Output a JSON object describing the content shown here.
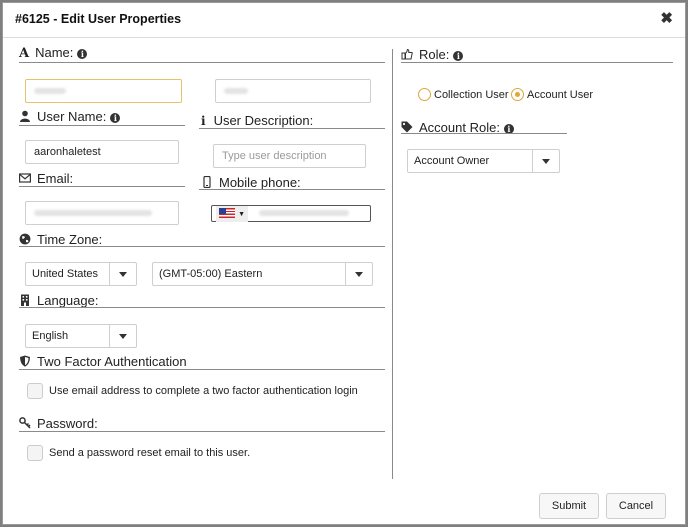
{
  "dialog": {
    "title": "#6125 - Edit User Properties"
  },
  "sections": {
    "name": "Name:",
    "username": "User Name:",
    "user_description": "User Description:",
    "email": "Email:",
    "mobile_phone": "Mobile phone:",
    "time_zone": "Time Zone:",
    "language": "Language:",
    "two_factor": "Two Factor Authentication",
    "password": "Password:",
    "role": "Role:",
    "account_role": "Account Role:"
  },
  "fields": {
    "username_value": "aaronhaletest",
    "description_placeholder": "Type user description",
    "country": "United States",
    "timezone": "(GMT-05:00) Eastern",
    "language": "English",
    "account_role": "Account Owner"
  },
  "checkboxes": {
    "two_factor_label": "Use email address to complete a two factor authentication login",
    "password_reset_label": "Send a password reset email to this user."
  },
  "roles": {
    "options": [
      "Collection User",
      "Account User"
    ],
    "selected": "Account User"
  },
  "buttons": {
    "submit": "Submit",
    "cancel": "Cancel"
  },
  "colors": {
    "accent": "#e0a53b",
    "border": "#cfcfcf"
  }
}
